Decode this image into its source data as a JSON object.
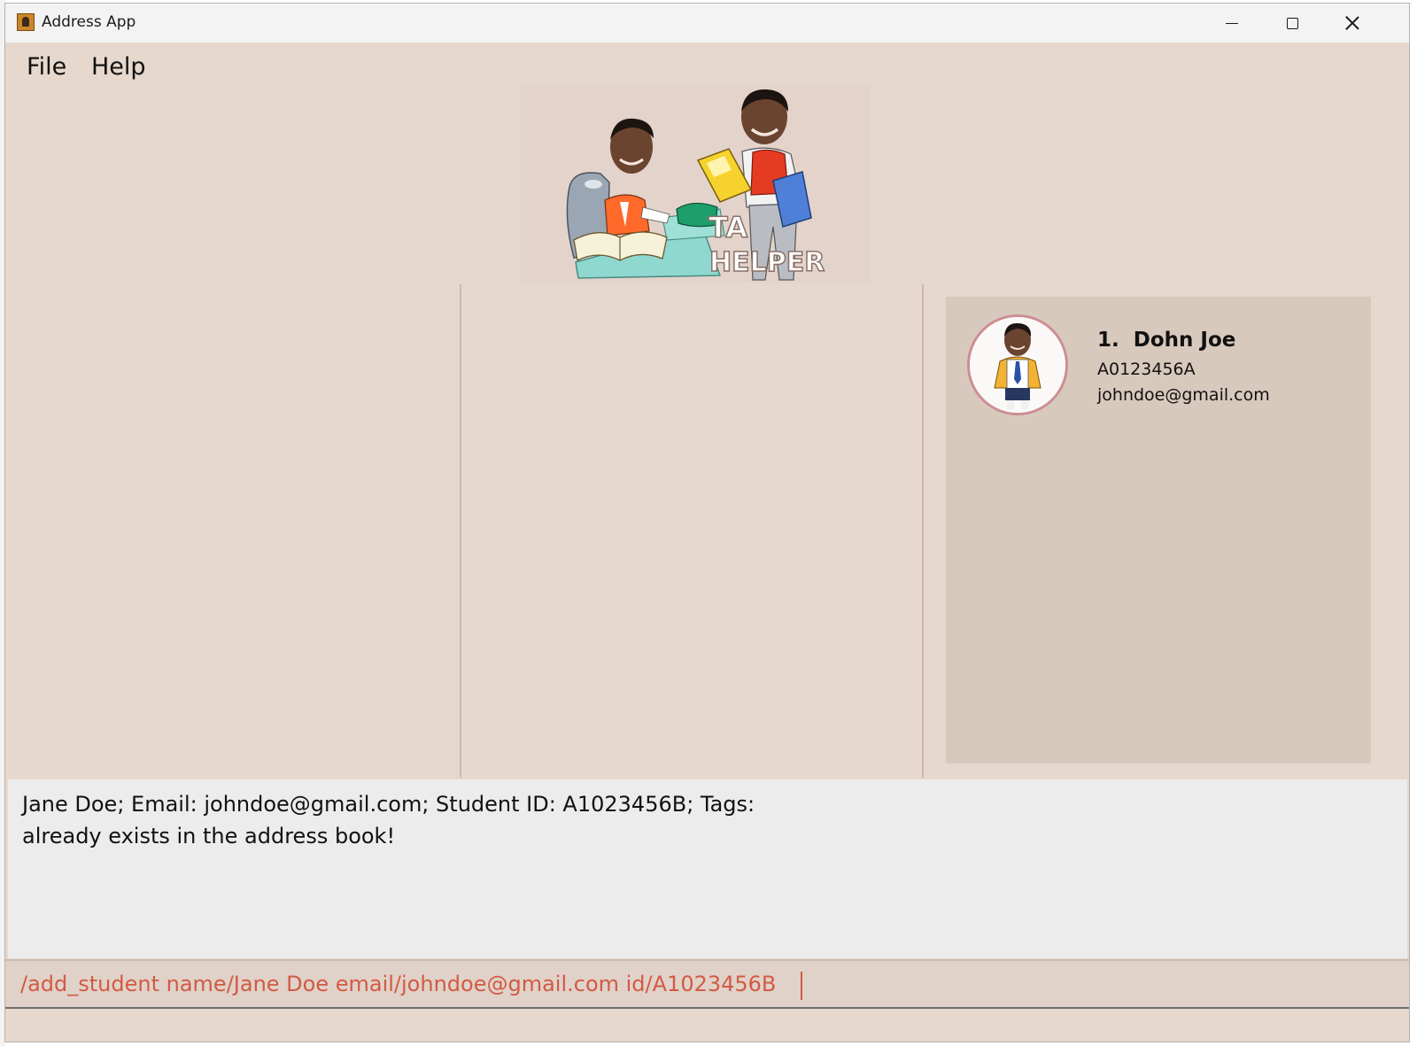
{
  "window": {
    "title": "Address App",
    "controls": [
      "minimize",
      "maximize",
      "close"
    ]
  },
  "menu": {
    "items": [
      {
        "label": "File"
      },
      {
        "label": "Help"
      }
    ]
  },
  "logo": {
    "text_line1": "TA",
    "text_line2": "HELPER"
  },
  "students": [
    {
      "index": "1.",
      "name": "Dohn Joe",
      "id": "A0123456A",
      "email": "johndoe@gmail.com"
    }
  ],
  "result": {
    "line1": "Jane Doe; Email: johndoe@gmail.com; Student ID: A1023456B; Tags:",
    "line2": "already exists in the address book!"
  },
  "command": {
    "value": "/add_student name/Jane Doe email/johndoe@gmail.com id/A1023456B"
  },
  "colors": {
    "background": "#e6d8cd",
    "list_panel": "#d8c9bd",
    "result_box": "#ececec",
    "command_text": "#d25a45",
    "avatar_border": "#cd8d93"
  }
}
